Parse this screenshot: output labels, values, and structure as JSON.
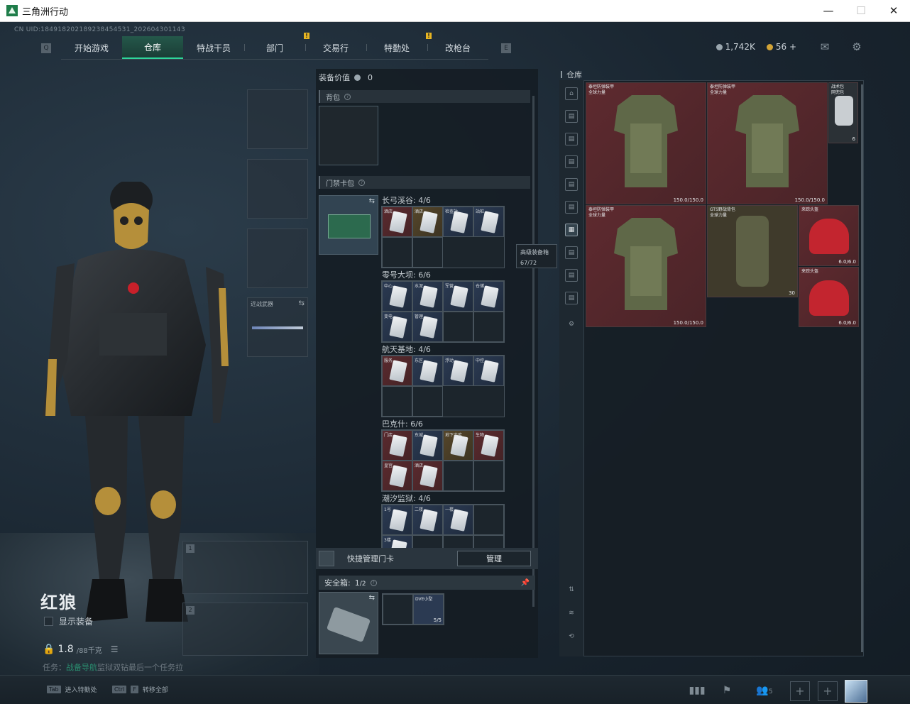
{
  "window": {
    "title": "三角洲行动",
    "minimize": "—",
    "maximize": "☐",
    "close": "✕"
  },
  "uid": "CN UID:184918202189238454531_202604301143",
  "nav": {
    "tabs": [
      {
        "label": "开始游戏",
        "active": false,
        "alert": false
      },
      {
        "label": "仓库",
        "active": true,
        "alert": false
      },
      {
        "label": "特战干员",
        "active": false,
        "alert": false
      },
      {
        "label": "部门",
        "active": false,
        "alert": true
      },
      {
        "label": "交易行",
        "active": false,
        "alert": false
      },
      {
        "label": "特勤处",
        "active": false,
        "alert": true
      },
      {
        "label": "改枪台",
        "active": false,
        "alert": false
      }
    ],
    "left_key": "Q",
    "right_key": "E",
    "alert_mark": "!"
  },
  "currency": {
    "silver": "1,742K",
    "gold": "56",
    "gold_add": "+"
  },
  "icons": {
    "mail": "mail-icon",
    "settings": "gear-icon"
  },
  "character": {
    "name": "红狼",
    "show_equipment": "显示装备",
    "weight": "1.8",
    "weight_max": "/88千克",
    "task_hint_prefix": "任务：",
    "task_hint_green": "战备导航",
    "task_hint_rest": "监狱双钻最后一个任务拉"
  },
  "gear_slots": {
    "melee_label": "近战武器",
    "weapon_slot_1": "1",
    "weapon_slot_2": "2"
  },
  "equipment": {
    "value_label": "装备价值",
    "value": "0",
    "backpack_label": "背包",
    "keycard_pack_label": "门禁卡包",
    "maps": [
      {
        "label": "长弓溪谷: 4/6",
        "cells": [
          {
            "name": "酒店",
            "tone": "red"
          },
          {
            "name": "酒店",
            "tone": "gold"
          },
          {
            "name": "检查站",
            "tone": "blue"
          },
          {
            "name": "站桩",
            "tone": "blue"
          }
        ]
      },
      {
        "label": "零号大坝: 6/6",
        "cells": [
          {
            "name": "中心",
            "tone": "blue"
          },
          {
            "name": "水泥",
            "tone": "blue"
          },
          {
            "name": "军营",
            "tone": "blue"
          },
          {
            "name": "仓储",
            "tone": "blue"
          },
          {
            "name": "变电",
            "tone": "blue"
          },
          {
            "name": "管理",
            "tone": "blue"
          }
        ]
      },
      {
        "label": "航天基地: 4/6",
        "cells": [
          {
            "name": "服务",
            "tone": "red"
          },
          {
            "name": "东区",
            "tone": "blue"
          },
          {
            "name": "浮动",
            "tone": "blue"
          },
          {
            "name": "中控",
            "tone": "blue"
          }
        ]
      },
      {
        "label": "巴克什: 6/6",
        "cells": [
          {
            "name": "门店",
            "tone": "red"
          },
          {
            "name": "东城",
            "tone": "blue"
          },
          {
            "name": "地下金库",
            "tone": "gold"
          },
          {
            "name": "生物",
            "tone": "red"
          },
          {
            "name": "皇宫",
            "tone": "red"
          },
          {
            "name": "酒店",
            "tone": "red"
          }
        ]
      },
      {
        "label": "潮汐监狱: 4/6",
        "cells": [
          {
            "name": "1号",
            "tone": "blue"
          },
          {
            "name": "二楼",
            "tone": "blue"
          },
          {
            "name": "一楼",
            "tone": "blue"
          },
          {
            "name": "",
            "tone": "empty"
          },
          {
            "name": "3楼",
            "tone": "blue"
          }
        ]
      }
    ],
    "tooltip_title": "高级装备箱",
    "tooltip_value": "67/72",
    "quick_manage_label": "快捷管理门卡",
    "manage_button": "管理",
    "safebox_label": "安全箱:",
    "safebox_count": "1",
    "safebox_max": "/2",
    "safebox_item_name": "DVE小型",
    "safebox_item_count": "5/5"
  },
  "warehouse": {
    "title": "仓库",
    "items": [
      {
        "name": "泰坦防弹装甲\n全球力量",
        "durability": "150.0/150.0"
      },
      {
        "name": "泰坦防弹装甲\n全球力量",
        "durability": "150.0/150.0"
      },
      {
        "name": "战术包\n网兜包",
        "durability": "6"
      },
      {
        "name": "泰坦防弹装甲\n全球力量",
        "durability": "150.0/150.0"
      },
      {
        "name": "GTS野战背包\n全球力量",
        "durability": "30"
      },
      {
        "name": "来踪头盔",
        "durability": "6.0/6.0"
      },
      {
        "name": "来踪头盔",
        "durability": "6.0/6.0"
      }
    ]
  },
  "bottom": {
    "tab_key": "Tab",
    "tab_label": "进入特勤处",
    "ctrl_key": "Ctrl",
    "f_key": "F",
    "ctrl_label": "转移全部",
    "friends_count": "5",
    "add": "+"
  }
}
